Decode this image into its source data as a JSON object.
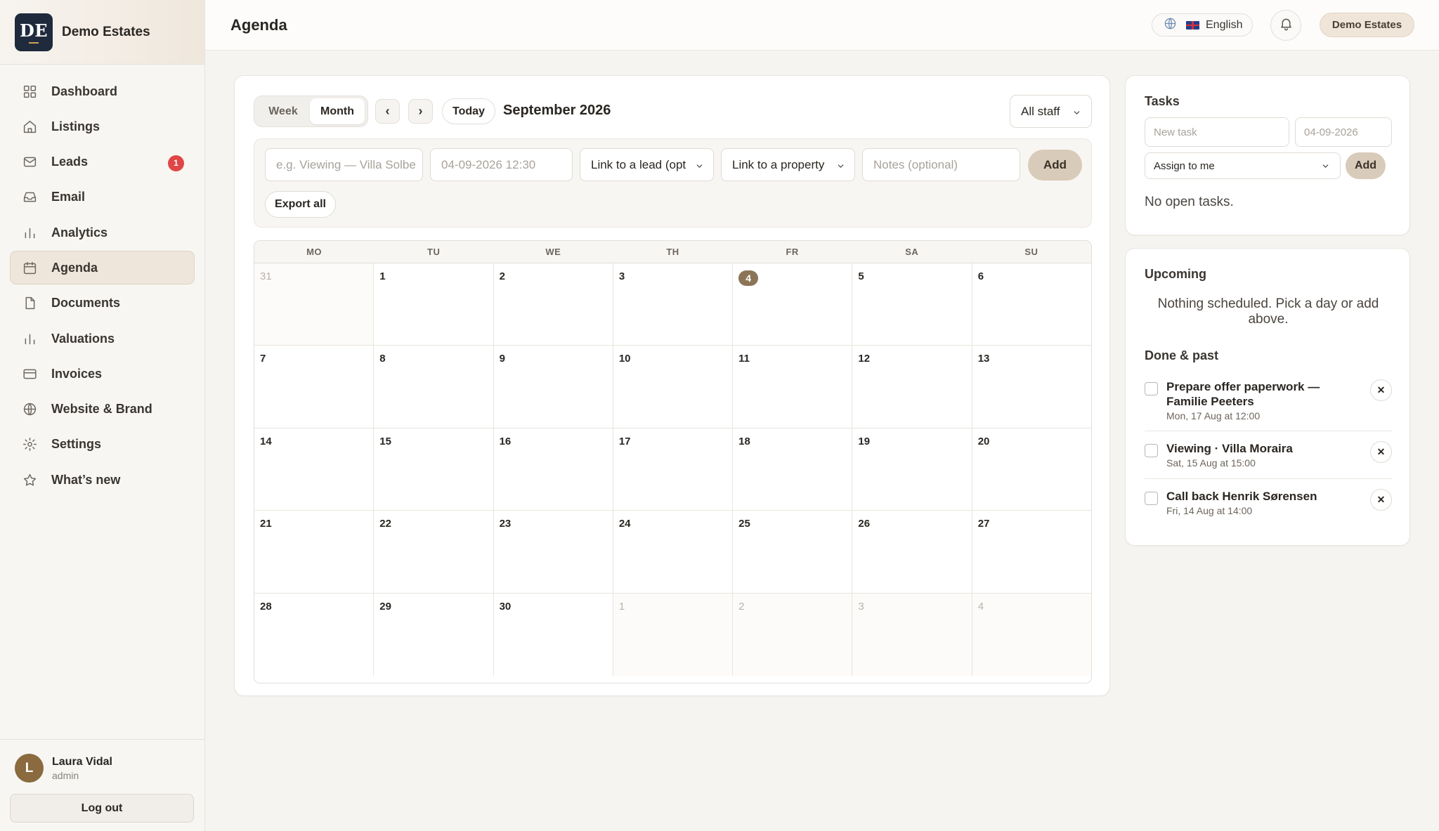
{
  "brand": {
    "logo": "DE",
    "name": "Demo Estates"
  },
  "sidebar": {
    "items": [
      {
        "label": "Dashboard",
        "icon": "dashboard-icon"
      },
      {
        "label": "Listings",
        "icon": "home-icon"
      },
      {
        "label": "Leads",
        "icon": "mail-icon",
        "badge": "1"
      },
      {
        "label": "Email",
        "icon": "inbox-icon"
      },
      {
        "label": "Analytics",
        "icon": "bar-chart-icon"
      },
      {
        "label": "Agenda",
        "icon": "calendar-icon",
        "active": true
      },
      {
        "label": "Documents",
        "icon": "document-icon"
      },
      {
        "label": "Valuations",
        "icon": "bar-chart-icon"
      },
      {
        "label": "Invoices",
        "icon": "credit-card-icon"
      },
      {
        "label": "Website & Brand",
        "icon": "globe-icon"
      },
      {
        "label": "Settings",
        "icon": "gear-icon"
      },
      {
        "label": "What’s new",
        "icon": "star-icon"
      }
    ]
  },
  "user": {
    "initial": "L",
    "name": "Laura Vidal",
    "role": "admin",
    "logout": "Log out"
  },
  "topbar": {
    "title": "Agenda",
    "language": "English",
    "org": "Demo Estates"
  },
  "calendar": {
    "views": {
      "week": "Week",
      "month": "Month",
      "active": "Month"
    },
    "prev": "‹",
    "next": "›",
    "today": "Today",
    "month_label": "September 2026",
    "staff": "All staff",
    "form": {
      "title_placeholder": "e.g. Viewing — Villa Solbe",
      "datetime": "04-09-2026 12:30",
      "lead": "Link to a lead (opt",
      "property": "Link to a property",
      "notes_placeholder": "Notes (optional)",
      "add": "Add",
      "export": "Export all"
    },
    "weekdays": [
      "MO",
      "TU",
      "WE",
      "TH",
      "FR",
      "SA",
      "SU"
    ],
    "today_date": "4",
    "weeks": [
      [
        {
          "d": "31",
          "m": true
        },
        {
          "d": "1"
        },
        {
          "d": "2"
        },
        {
          "d": "3"
        },
        {
          "d": "4",
          "t": true
        },
        {
          "d": "5"
        },
        {
          "d": "6"
        }
      ],
      [
        {
          "d": "7"
        },
        {
          "d": "8"
        },
        {
          "d": "9"
        },
        {
          "d": "10"
        },
        {
          "d": "11"
        },
        {
          "d": "12"
        },
        {
          "d": "13"
        }
      ],
      [
        {
          "d": "14"
        },
        {
          "d": "15"
        },
        {
          "d": "16"
        },
        {
          "d": "17"
        },
        {
          "d": "18"
        },
        {
          "d": "19"
        },
        {
          "d": "20"
        }
      ],
      [
        {
          "d": "21"
        },
        {
          "d": "22"
        },
        {
          "d": "23"
        },
        {
          "d": "24"
        },
        {
          "d": "25"
        },
        {
          "d": "26"
        },
        {
          "d": "27"
        }
      ],
      [
        {
          "d": "28"
        },
        {
          "d": "29"
        },
        {
          "d": "30"
        },
        {
          "d": "1",
          "m": true
        },
        {
          "d": "2",
          "m": true
        },
        {
          "d": "3",
          "m": true
        },
        {
          "d": "4",
          "m": true
        }
      ]
    ]
  },
  "tasks": {
    "title": "Tasks",
    "new_placeholder": "New task",
    "date_placeholder": "04-09-2026",
    "assign": "Assign to me",
    "add": "Add",
    "empty": "No open tasks."
  },
  "upcoming": {
    "title": "Upcoming",
    "empty": "Nothing scheduled. Pick a day or add above.",
    "done_title": "Done & past",
    "items": [
      {
        "title": "Prepare offer paperwork — Familie Peeters",
        "when": "Mon, 17 Aug at 12:00"
      },
      {
        "title": "Viewing · Villa Moraira",
        "when": "Sat, 15 Aug at 15:00"
      },
      {
        "title": "Call back Henrik Sørensen",
        "when": "Fri, 14 Aug at 14:00"
      }
    ]
  },
  "colors": {
    "accent": "#d9cbb9",
    "today": "#8c7556",
    "badge": "#e04646",
    "logo_bg": "#1f2a3d"
  }
}
